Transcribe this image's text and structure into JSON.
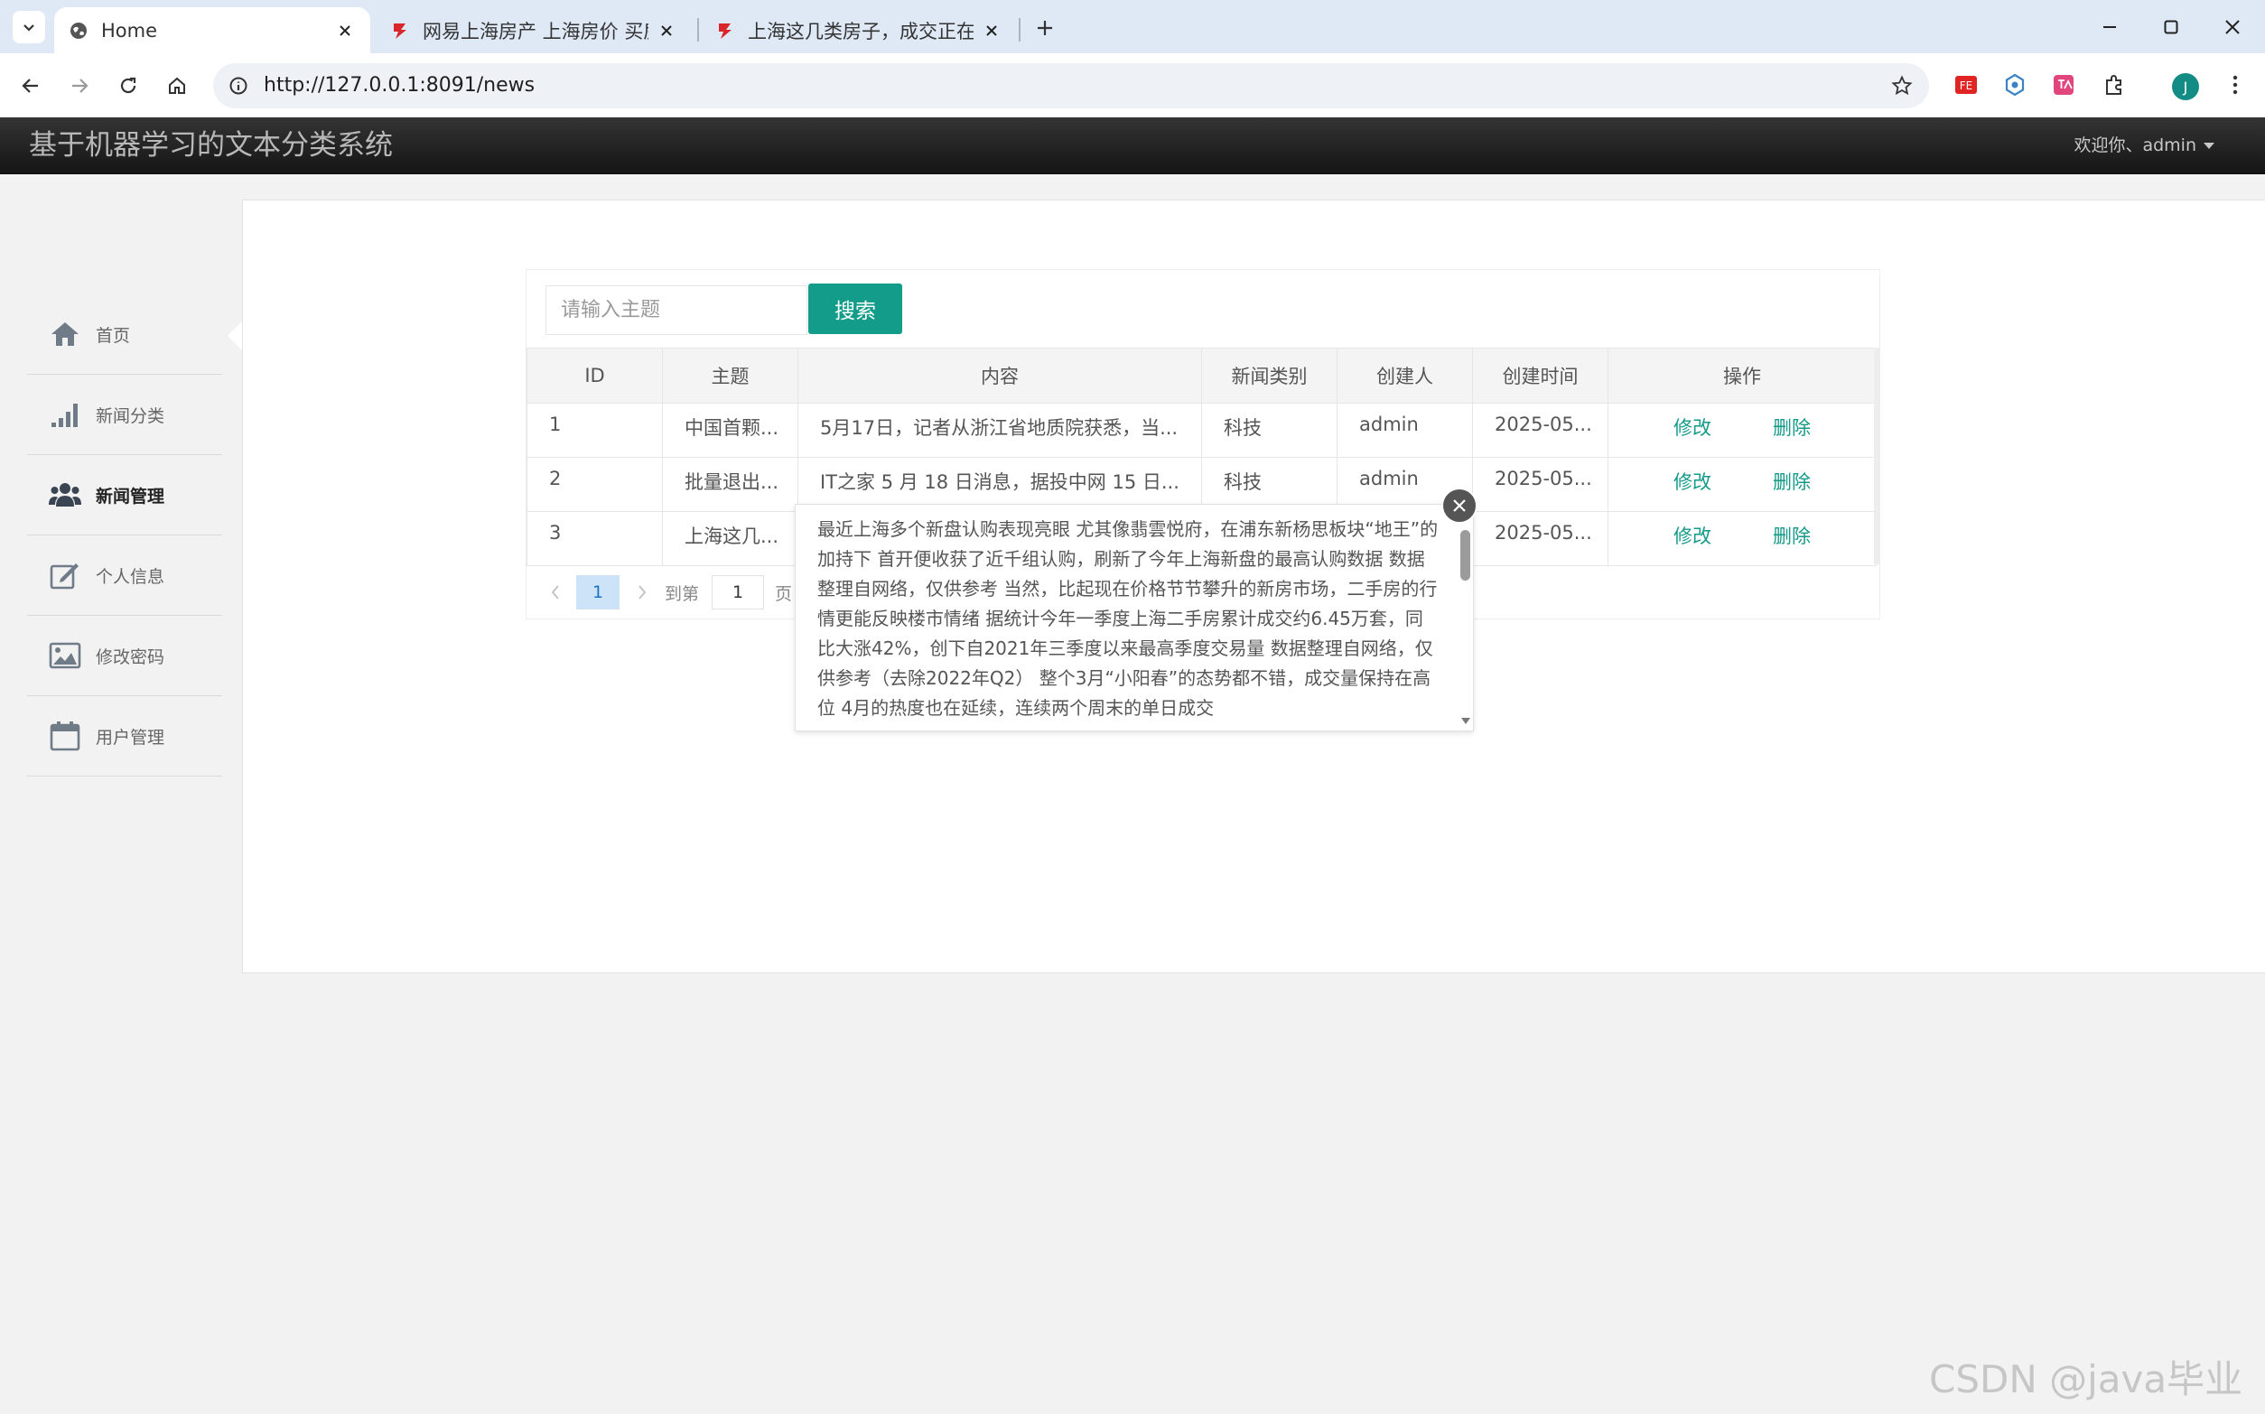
{
  "browser": {
    "tabs": [
      {
        "title": "Home",
        "active": true
      },
      {
        "title": "网易上海房产 上海房价 买房 ",
        "active": false
      },
      {
        "title": "上海这几类房子，成交正在快速",
        "active": false
      }
    ],
    "url": "http://127.0.0.1:8091/news",
    "profile_initial": "J"
  },
  "app": {
    "title": "基于机器学习的文本分类系统",
    "welcome": "欢迎你、admin"
  },
  "sidebar": {
    "items": [
      {
        "label": "首页",
        "icon": "home-icon"
      },
      {
        "label": "新闻分类",
        "icon": "signal-icon"
      },
      {
        "label": "新闻管理",
        "icon": "users-icon"
      },
      {
        "label": "个人信息",
        "icon": "edit-icon"
      },
      {
        "label": "修改密码",
        "icon": "image-icon"
      },
      {
        "label": "用户管理",
        "icon": "calendar-icon"
      }
    ],
    "active_index": 2
  },
  "search": {
    "placeholder": "请输入主题",
    "button": "搜索"
  },
  "table": {
    "columns": [
      "ID",
      "主题",
      "内容",
      "新闻类别",
      "创建人",
      "创建时间",
      "操作"
    ],
    "rows": [
      {
        "id": "1",
        "subject": "中国首颗...",
        "content": "5月17日，记者从浙江省地质院获悉，当...",
        "category": "科技",
        "creator": "admin",
        "created": "2025-05..."
      },
      {
        "id": "2",
        "subject": "批量退出...",
        "content": "IT之家 5 月 18 日消息，据投中网 15 日...",
        "category": "科技",
        "creator": "admin",
        "created": "2025-05..."
      },
      {
        "id": "3",
        "subject": "上海这几...",
        "content": "",
        "category": "",
        "creator": "",
        "created": "2025-05..."
      }
    ],
    "edit_label": "修改",
    "delete_label": "删除"
  },
  "pager": {
    "current": "1",
    "goto_label": "到第",
    "goto_value": "1",
    "unit": "页"
  },
  "tooltip": {
    "text": "最近上海多个新盘认购表现亮眼 尤其像翡雲悦府，在浦东新杨思板块“地王”的加持下 首开便收获了近千组认购，刷新了今年上海新盘的最高认购数据 数据整理自网络，仅供参考 当然，比起现在价格节节攀升的新房市场，二手房的行情更能反映楼市情绪 据统计今年一季度上海二手房累计成交约6.45万套，同比大涨42%，创下自2021年三季度以来最高季度交易量 数据整理自网络，仅供参考（去除2022年Q2） 整个3月“小阳春”的态势都不错，成交量保持在高位 4月的热度也在延续，连续两个周末的单日成交"
  },
  "watermark": "CSDN @java毕业",
  "colors": {
    "accent": "#129c89",
    "header_bg": "#1f1f1f",
    "page_bg": "#f2f2f2"
  }
}
